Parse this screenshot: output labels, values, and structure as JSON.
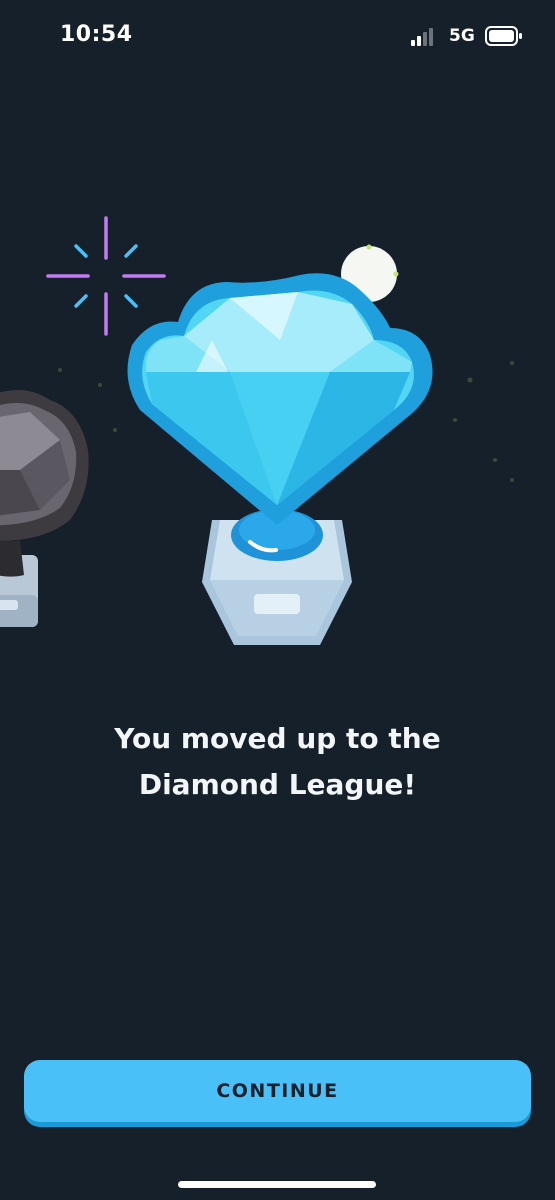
{
  "status_bar": {
    "time": "10:54",
    "network": "5G",
    "signal_icon": "cellular-signal-icon",
    "battery_icon": "battery-icon"
  },
  "promotion": {
    "message": "You moved up to the Diamond League!",
    "trophy": "diamond-trophy",
    "previous_trophy": "obsidian-trophy"
  },
  "actions": {
    "continue_label": "CONTINUE"
  },
  "colors": {
    "background": "#16202a",
    "button": "#49c0f8",
    "button_shadow": "#1a9ad6",
    "diamond": "#52d6f4",
    "sparkle_purple": "#c27cf2",
    "sparkle_blue": "#49c0f8"
  }
}
